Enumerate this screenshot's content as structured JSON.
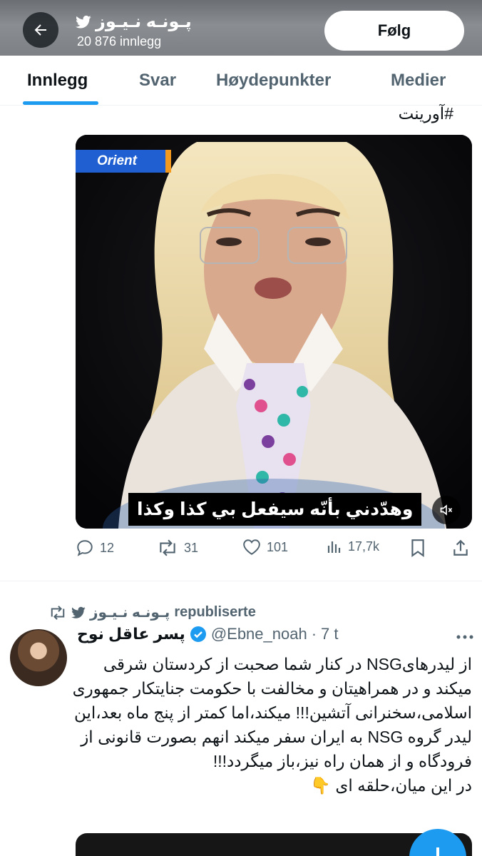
{
  "header": {
    "title": "پـونـه نـیـوز",
    "subtitle": "20 876 innlegg",
    "follow_label": "Følg"
  },
  "tabs": [
    {
      "label": "Innlegg",
      "active": true
    },
    {
      "label": "Svar",
      "active": false
    },
    {
      "label": "Høydepunkter",
      "active": false
    },
    {
      "label": "Medier",
      "active": false
    }
  ],
  "post1": {
    "hashtag": "#آورینت",
    "media": {
      "logo": "Orient",
      "caption": "وهدّدني بأنّه سيفعل بي كذا وكذا"
    },
    "actions": {
      "replies": "12",
      "reposts": "31",
      "likes": "101",
      "views": "17,7k"
    }
  },
  "post2": {
    "repost_label": "republiserte",
    "repost_by": "پـونـه نـیـوز",
    "author_name": "پسر عاقل نوح",
    "handle": "@Ebne_noah",
    "time": "7 t",
    "body": "از لیدرهایNSG در کنار شما صحبت از کردستان شرقی میکند و در همراهیتان و مخالفت با حکومت جنایتکار جمهوری اسلامی،سخنرانی آتشین!!! میکند،اما کمتر از پنج ماه بعد،این لیدر گروه NSG به ایران سفر میکند انهم بصورت قانونی از فرودگاه و از همان راه نیز،باز میگردد!!!\nدر این میان،حلقه ای 👇"
  },
  "colors": {
    "accent": "#1d9bf0",
    "text": "#0f1419",
    "muted": "#536471"
  }
}
